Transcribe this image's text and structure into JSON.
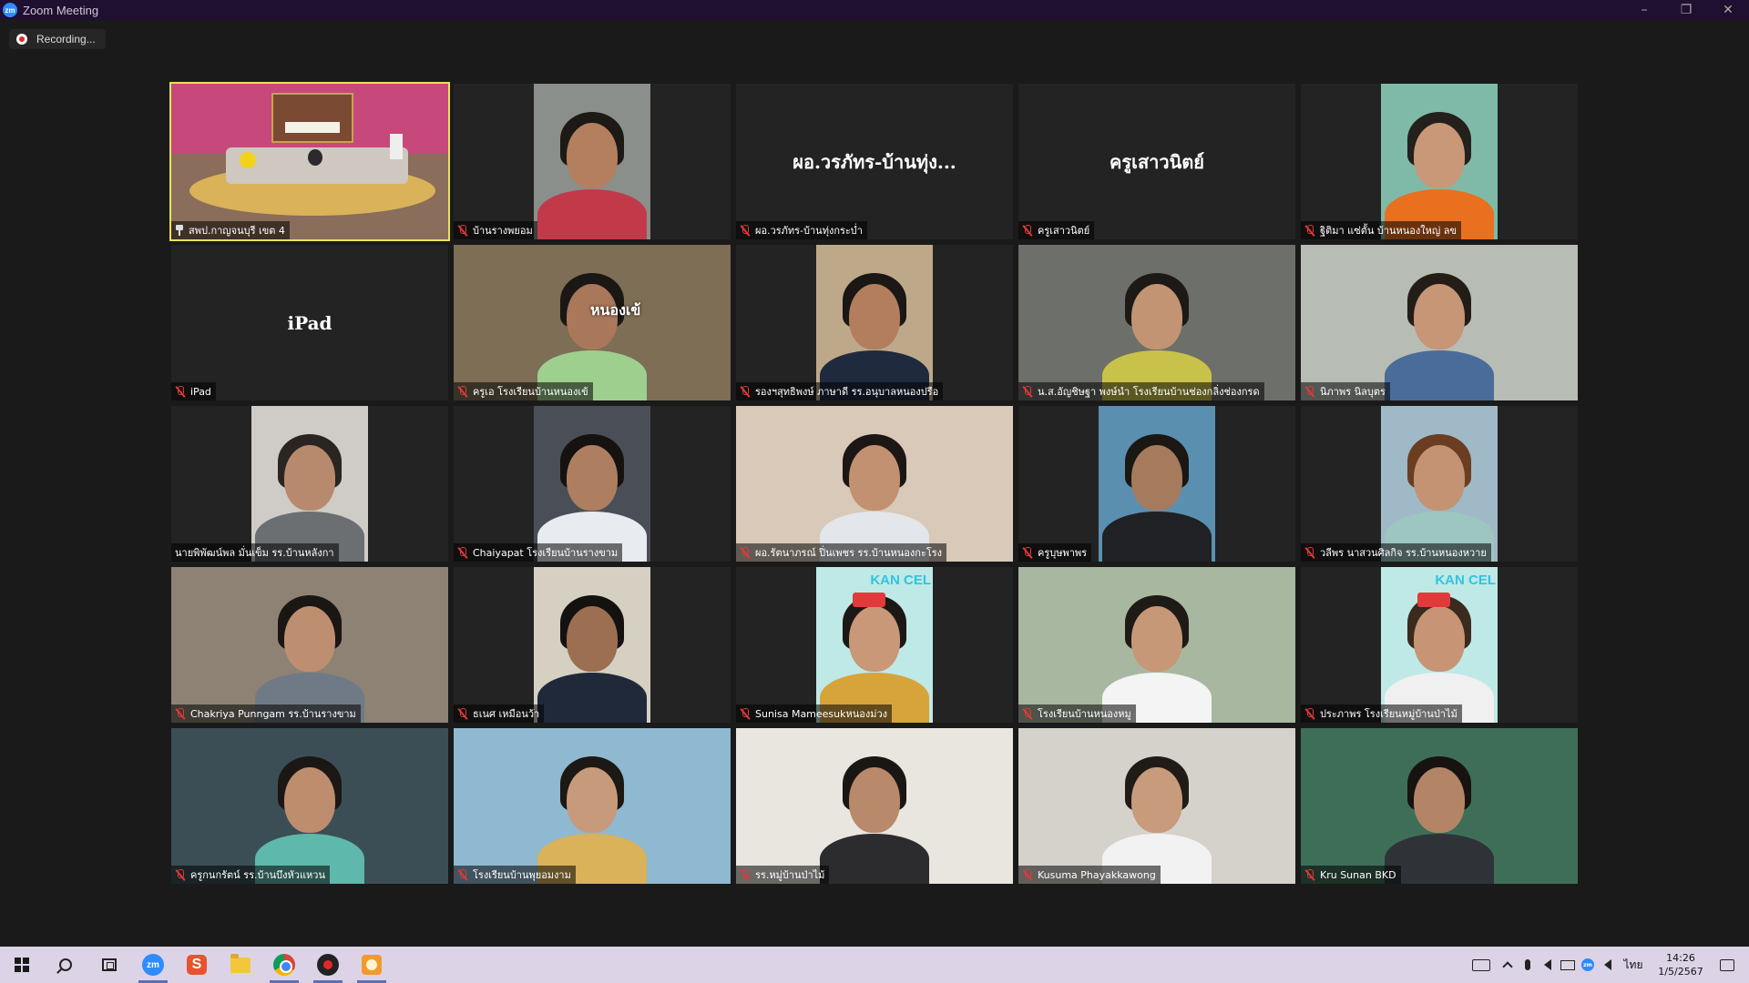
{
  "window": {
    "title": "Zoom Meeting",
    "logo_text": "zm"
  },
  "recording": {
    "label": "Recording..."
  },
  "tiles": [
    {
      "name": "สพป.กาญจนบุรี เขต 4",
      "tag_icon": "pin",
      "active": true,
      "kind": "room"
    },
    {
      "name": "บ้านรางพยอม",
      "tag_icon": "mute",
      "kind": "portrait",
      "bg": "#8a8f8c",
      "skin": "#b47f5e",
      "hair": "#1d1915",
      "shirt": "#c23a4a"
    },
    {
      "name": "ผอ.วรภัทร-บ้านทุ่งกระบ่ำ",
      "big_name": "ผอ.วรภัทร-บ้านทุ่ง...",
      "tag_icon": "mute",
      "kind": "name"
    },
    {
      "name": "ครูเสาวนิตย์",
      "big_name": "ครูเสาวนิตย์",
      "tag_icon": "mute",
      "kind": "name"
    },
    {
      "name": "ฐิติมา แซ่ตั้น บ้านหนองใหญ่ ลข",
      "tag_icon": "mute",
      "kind": "portrait",
      "bg": "#7fbaa9",
      "skin": "#c99878",
      "hair": "#24201b",
      "shirt": "#e8701f"
    },
    {
      "name": "iPad",
      "big_name": "iPad",
      "tag_icon": "mute",
      "kind": "name"
    },
    {
      "name": "ครูเอ โรงเรียนบ้านหนองเข้",
      "tag_icon": "mute",
      "kind": "full",
      "bg": "#7d6e55",
      "skin": "#a9775a",
      "hair": "#1a1714",
      "shirt": "#9ecf8e",
      "overlay": "หนองเข้"
    },
    {
      "name": "รองฯสุทธิพงษ์ ภาษาดี รร.อนุบาลหนองปรือ",
      "tag_icon": "mute",
      "kind": "portrait",
      "bg": "#bda98a",
      "skin": "#b27e5d",
      "hair": "#1b1714",
      "shirt": "#1f2a3f"
    },
    {
      "name": "น.ส.อัญชิษฐา พงษ์นำ โรงเรียนบ้านช่องกลิ่งช่องกรด",
      "tag_icon": "mute",
      "kind": "full",
      "bg": "#6d6f6a",
      "skin": "#c29473",
      "hair": "#1c1916",
      "shirt": "#c9c24a"
    },
    {
      "name": "นิภาพร นิลบุตร",
      "tag_icon": "mute",
      "kind": "full",
      "bg": "#b7bcb4",
      "skin": "#c69676",
      "hair": "#231d18",
      "shirt": "#4a6c9a"
    },
    {
      "name": "นายพิพัฒน์พล มั่นเข็ม รร.บ้านหลังกา",
      "tag_icon": "",
      "kind": "portrait-narrow",
      "bg": "#cfcbc6",
      "skin": "#b88a6d",
      "hair": "#2a2521",
      "shirt": "#6b6f72"
    },
    {
      "name": "Chaiyapat โรงเรียนบ้านรางขาม",
      "tag_icon": "mute",
      "kind": "portrait",
      "bg": "#4a4e57",
      "skin": "#ad7f60",
      "hair": "#151210",
      "shirt": "#e8ecf0"
    },
    {
      "name": "ผอ.รัตนาภรณ์ ปิ่นเพชร รร.บ้านหนองกะโรง",
      "tag_icon": "mute",
      "kind": "full",
      "bg": "#d8c9b8",
      "skin": "#c19171",
      "hair": "#1c1714",
      "shirt": "#e3e6ea"
    },
    {
      "name": "ครูบุษพาพร",
      "tag_icon": "mute",
      "kind": "portrait-narrow",
      "bg": "#5a8fb0",
      "skin": "#a67a5c",
      "hair": "#1b1713",
      "shirt": "#1f2124"
    },
    {
      "name": "วลีพร นาสวนศิลกิจ รร.บ้านหนองหวาย",
      "tag_icon": "mute",
      "kind": "portrait-narrow",
      "bg": "#9fb9c7",
      "skin": "#c39373",
      "hair": "#6b3e22",
      "shirt": "#9dc6c0"
    },
    {
      "name": "Chakriya Punngam รร.บ้านรางขาม",
      "tag_icon": "mute",
      "kind": "full",
      "bg": "#8d8274",
      "skin": "#bd8f70",
      "hair": "#1a1613",
      "shirt": "#6f7a86"
    },
    {
      "name": "ธเนศ เหมือนว้า",
      "tag_icon": "mute",
      "kind": "portrait-narrow",
      "bg": "#d5d0c2",
      "skin": "#9c6f52",
      "hair": "#141210",
      "shirt": "#20293a"
    },
    {
      "name": "Sunisa Mameesukหนองม่วง",
      "tag_icon": "mute",
      "kind": "portrait-narrow",
      "bg": "#bfe9e6",
      "skin": "#c89878",
      "hair": "#1c1815",
      "shirt": "#d7a43c",
      "badge": "KAN CEL"
    },
    {
      "name": "โรงเรียนบ้านหนองหมู",
      "tag_icon": "mute",
      "kind": "full",
      "bg": "#a8b8a0",
      "skin": "#c69878",
      "hair": "#1e1a16",
      "shirt": "#f4f4f4"
    },
    {
      "name": "ประภาพร โรงเรียนหมู่บ้านป่าไม้",
      "tag_icon": "mute",
      "kind": "portrait-narrow",
      "bg": "#bfe9e6",
      "skin": "#c79575",
      "hair": "#3b2a1e",
      "shirt": "#f0f0f0",
      "badge": "KAN CEL"
    },
    {
      "name": "ครูกนกรัตน์ รร.บ้านบึงหัวแหวน",
      "tag_icon": "mute",
      "kind": "full",
      "bg": "#3b4e56",
      "skin": "#bd8d6d",
      "hair": "#1b1714",
      "shirt": "#5fb8ac"
    },
    {
      "name": "โรงเรียนบ้านพุยอมงาม",
      "tag_icon": "mute",
      "kind": "full",
      "bg": "#8fb9d0",
      "skin": "#c79a7b",
      "hair": "#1c1814",
      "shirt": "#d9b25a"
    },
    {
      "name": "รร.หมู่บ้านป่าไม้",
      "tag_icon": "mute",
      "kind": "full",
      "bg": "#e9e6e0",
      "skin": "#b8896a",
      "hair": "#1a1613",
      "shirt": "#2c2c2e"
    },
    {
      "name": "Kusuma Phayakkawong",
      "tag_icon": "mute",
      "kind": "full",
      "bg": "#d5d2cc",
      "skin": "#c79b7c",
      "hair": "#201b17",
      "shirt": "#f2f2f2"
    },
    {
      "name": "Kru Sunan BKD",
      "tag_icon": "mute",
      "kind": "full",
      "bg": "#3e6e58",
      "skin": "#b38566",
      "hair": "#161310",
      "shirt": "#2f3338"
    }
  ],
  "taskbar": {
    "zoom_text": "zm",
    "s_app_text": "S",
    "tray_lang": "ไทย",
    "tray_zoom_text": "zm",
    "time": "14:26",
    "date": "1/5/2567"
  },
  "colors": {
    "active_border": "#e8e25a",
    "mute_red": "#e23838",
    "titlebar": "#1f0f30",
    "taskbar": "#dcd4e6"
  }
}
